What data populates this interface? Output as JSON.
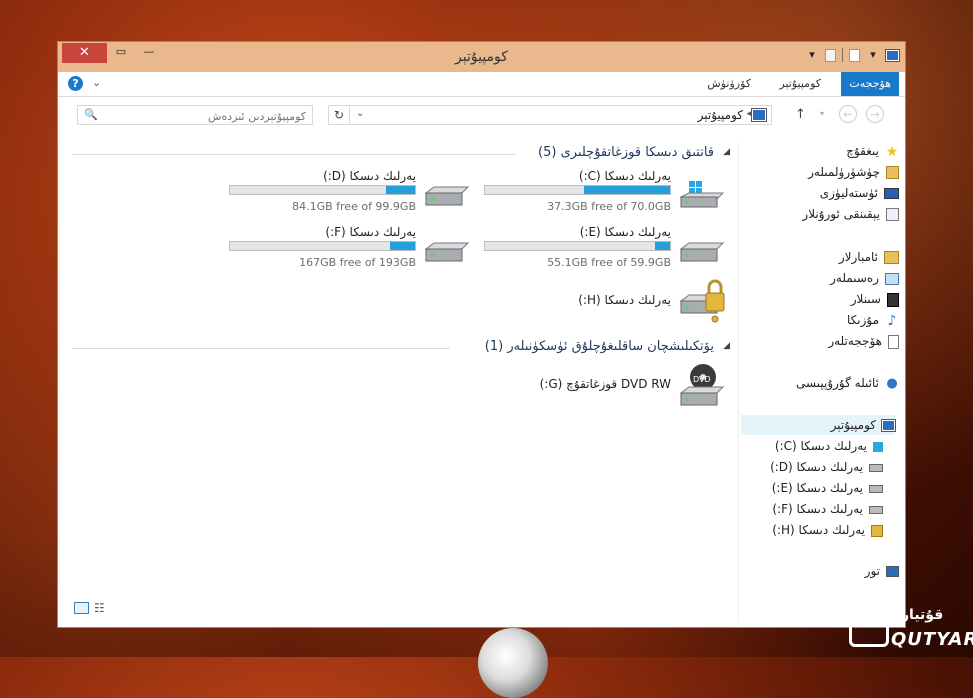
{
  "window": {
    "title": "كومپيۇتېر",
    "close_label": "✕",
    "maximize_label": "▭",
    "minimize_label": "—"
  },
  "ribbon": {
    "tabs": [
      {
        "label": "ھۆججەت"
      },
      {
        "label": "كومپيۇتېر"
      },
      {
        "label": "كۆرۈنۈش"
      }
    ],
    "help_label": "?"
  },
  "address": {
    "crumb": "كومپيۇتېر",
    "search_placeholder": "كومپيۇتېردىن ئىزدەش"
  },
  "groups": {
    "hdd": {
      "title": "قاتتىق دىسكا قوزغاتقۇچلىرى (5)"
    },
    "removable": {
      "title": "يۆتكىلىشچان ساقلىغۇچلۇق ئۈسكۈنىلەر (1)"
    }
  },
  "drives": [
    {
      "label": "يەرلىك دىسكا (C:)",
      "free": "37.3GB free of 70.0GB",
      "used_fraction": 0.467
    },
    {
      "label": "يەرلىك دىسكا (D:)",
      "free": "84.1GB free of 99.9GB",
      "used_fraction": 0.158
    },
    {
      "label": "يەرلىك دىسكا (E:)",
      "free": "55.1GB free of 59.9GB",
      "used_fraction": 0.08
    },
    {
      "label": "يەرلىك دىسكا (F:)",
      "free": "167GB free of 193GB",
      "used_fraction": 0.135
    },
    {
      "label": "يەرلىك دىسكا (H:)"
    }
  ],
  "dvd": {
    "label": "DVD RW قوزغاتقۇچ (G:)",
    "badge": "DVD"
  },
  "sidebar": {
    "favorites": "يىغقۇچ",
    "downloads": "چۈشۈرۈلمىلەر",
    "desktop": "ئۈستەلیۈزى",
    "recent": "يېقىنقى ئورۇنلار",
    "libraries": "ئامبارلار",
    "pictures": "رەسىملەر",
    "videos": "سىنلار",
    "music": "مۇزىكا",
    "documents": "ھۆججەتلەر",
    "homegroup": "ئائىلە گۇرۇپپىسى",
    "computer": "كومپيۇتېر",
    "drives": [
      "يەرلىك دىسكا (C:)",
      "يەرلىك دىسكا (D:)",
      "يەرلىك دىسكا (E:)",
      "يەرلىك دىسكا (F:)",
      "يەرلىك دىسكا (H:)"
    ],
    "network": "تور"
  },
  "watermark": {
    "latin": "QUTYAR",
    "arabic": "قۇتيار"
  },
  "colors": {
    "accent": "#1979ca",
    "bar_fill": "#26a0da",
    "close": "#c7453b",
    "frame": "#e9b98d"
  }
}
